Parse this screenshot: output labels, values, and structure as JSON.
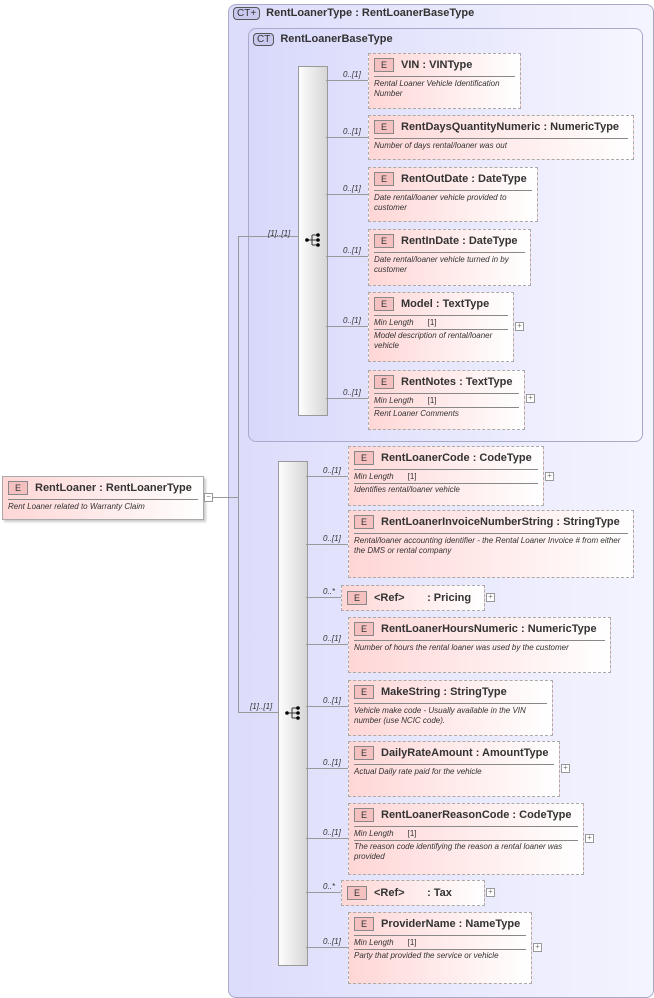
{
  "root": {
    "name": "RentLoaner",
    "type": "RentLoanerType",
    "desc": "Rent Loaner related to Warranty Claim"
  },
  "outer_ct": {
    "badge": "CT+",
    "title": "RentLoanerType : RentLoanerBaseType"
  },
  "inner_ct": {
    "badge": "CT",
    "title": "RentLoanerBaseType"
  },
  "seq_label": "[1]..[1]",
  "elem_badge": "E",
  "min_length_label": "Min Length",
  "inner_elements": [
    {
      "name": "VIN",
      "type": ": VINType",
      "mult": "0..[1]",
      "desc": "Rental Loaner Vehicle Identification Number"
    },
    {
      "name": "RentDaysQuantityNumeric",
      "type": ": NumericType",
      "mult": "0..[1]",
      "desc": "Number of days rental/loaner was out"
    },
    {
      "name": "RentOutDate",
      "type": ": DateType",
      "mult": "0..[1]",
      "desc": "Date rental/loaner vehicle provided to customer"
    },
    {
      "name": "RentInDate",
      "type": ": DateType",
      "mult": "0..[1]",
      "desc": "Date rental/loaner vehicle turned in by customer"
    },
    {
      "name": "Model",
      "type": ": TextType",
      "mult": "0..[1]",
      "min": "[1]",
      "desc": "Model description of rental/loaner vehicle",
      "expand": true
    },
    {
      "name": "RentNotes",
      "type": ": TextType",
      "mult": "0..[1]",
      "min": "[1]",
      "desc": "Rent Loaner Comments",
      "expand": true
    }
  ],
  "outer_elements": [
    {
      "name": "RentLoanerCode",
      "type": ": CodeType",
      "mult": "0..[1]",
      "min": "[1]",
      "desc": "Identifies rental/loaner vehicle",
      "expand": true
    },
    {
      "name": "RentLoanerInvoiceNumberString",
      "type": ": StringType",
      "mult": "0..[1]",
      "desc": "Rental/loaner accounting identifier - the Rental Loaner Invoice # from either the DMS or rental company"
    },
    {
      "name": "<Ref>",
      "type": ": Pricing",
      "mult": "0..*",
      "ref": true,
      "expand": true
    },
    {
      "name": "RentLoanerHoursNumeric",
      "type": ": NumericType",
      "mult": "0..[1]",
      "desc": "Number of hours the rental loaner was used by the customer"
    },
    {
      "name": "MakeString",
      "type": ": StringType",
      "mult": "0..[1]",
      "desc": "Vehicle make code - Usually available in the VIN number (use NCIC code)."
    },
    {
      "name": "DailyRateAmount",
      "type": ": AmountType",
      "mult": "0..[1]",
      "desc": "Actual Daily rate paid for the vehicle",
      "expand": true
    },
    {
      "name": "RentLoanerReasonCode",
      "type": ": CodeType",
      "mult": "0..[1]",
      "min": "[1]",
      "desc": "The reason code identifying the reason a rental loaner was provided",
      "expand": true
    },
    {
      "name": "<Ref>",
      "type": ": Tax",
      "mult": "0..*",
      "ref": true,
      "expand": true
    },
    {
      "name": "ProviderName",
      "type": ": NameType",
      "mult": "0..[1]",
      "min": "[1]",
      "desc": "Party that provided the service or vehicle",
      "expand": true
    }
  ]
}
